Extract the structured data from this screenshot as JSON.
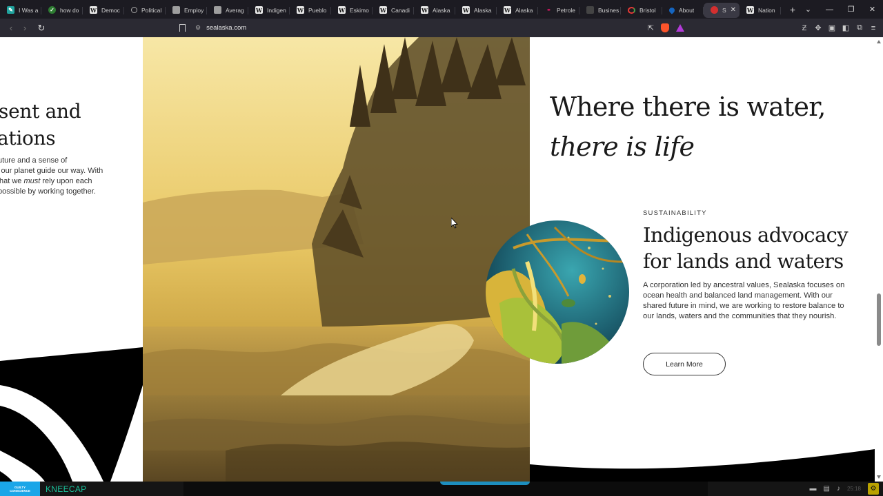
{
  "browser": {
    "tabs": [
      {
        "label": "I Was a",
        "icon": "teal"
      },
      {
        "label": "how do",
        "icon": "green"
      },
      {
        "label": "Democ",
        "icon": "w"
      },
      {
        "label": "Political",
        "icon": "globe"
      },
      {
        "label": "Employ",
        "icon": "doc"
      },
      {
        "label": "Averag",
        "icon": "doc"
      },
      {
        "label": "Indigen",
        "icon": "w"
      },
      {
        "label": "Pueblo",
        "icon": "w"
      },
      {
        "label": "Eskimo",
        "icon": "w"
      },
      {
        "label": "Canadi",
        "icon": "w"
      },
      {
        "label": "Alaska",
        "icon": "w"
      },
      {
        "label": "Alaska",
        "icon": "w"
      },
      {
        "label": "Alaska",
        "icon": "w"
      },
      {
        "label": "Petrole",
        "icon": "purple"
      },
      {
        "label": "Busines",
        "icon": "dark"
      },
      {
        "label": "Bristol",
        "icon": "ring"
      },
      {
        "label": "About",
        "icon": "blue"
      },
      {
        "label": "Se",
        "icon": "red",
        "active": true
      },
      {
        "label": "Nation",
        "icon": "w"
      }
    ],
    "new_tab": "+",
    "url": "sealaska.com"
  },
  "page": {
    "left": {
      "heading_line1": "sent and",
      "heading_line2": "ations",
      "body_line1": "uture and a sense of",
      "body_line2": "l our planet guide our way. With",
      "body_line3a": "hat we ",
      "body_line3b": "must",
      "body_line3c": " rely upon each",
      "body_line4": "possible by working together."
    },
    "title_line1": "Where there is water,",
    "title_line2": "there is life",
    "eyebrow": "SUSTAINABILITY",
    "section_heading": "Indigenous advocacy for lands and waters",
    "section_body": "A corporation led by ancestral values, Sealaska focuses on ocean health and balanced land management. With our shared future in mind, we are working to restore balance to our lands, waters and the communities that they nourish.",
    "cta_label": "Learn More"
  },
  "taskbar": {
    "thumb_text_line1": "GUILTY",
    "thumb_text_line2": "CONSCIENCE",
    "window_title": "KNEECAP",
    "clock": "25:18"
  },
  "colors": {
    "tab_bg": "#1c1b22",
    "toolbar_bg": "#2b2a33",
    "page_bg": "#ffffff",
    "ink": "#1a1a1a",
    "taskbar_accent": "#19c29b"
  }
}
